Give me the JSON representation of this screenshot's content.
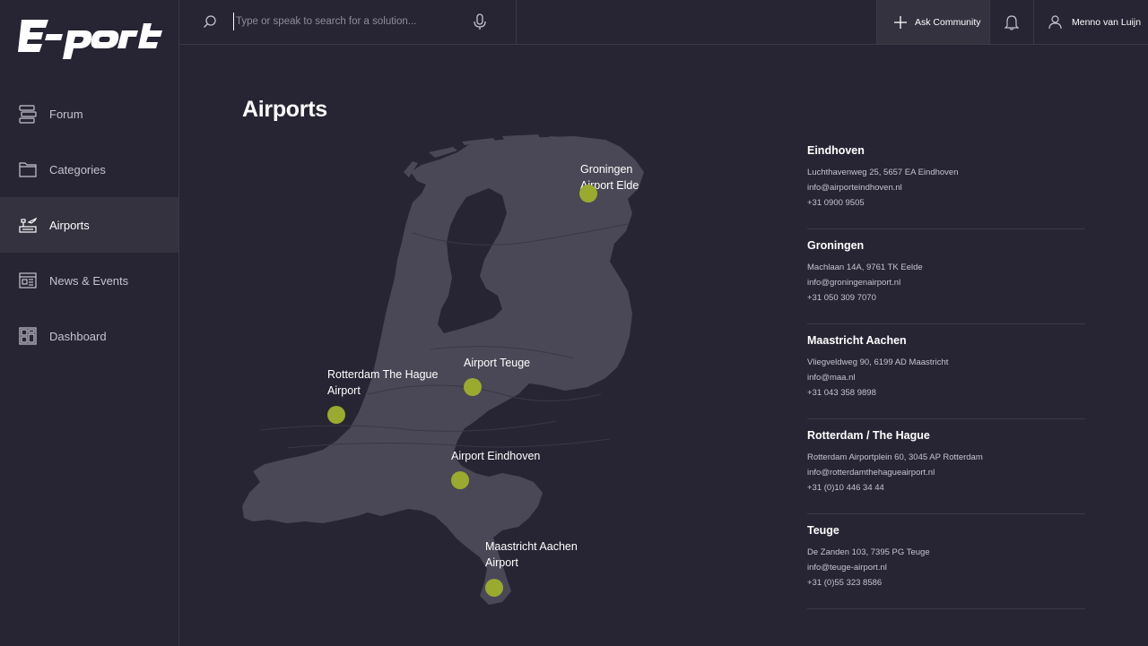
{
  "brand": {
    "logo_text": "E-port",
    "accent": "#9aaa2e"
  },
  "sidebar": {
    "items": [
      {
        "label": "Forum",
        "icon": "forum-icon",
        "active": false
      },
      {
        "label": "Categories",
        "icon": "folder-icon",
        "active": false
      },
      {
        "label": "Airports",
        "icon": "airport-icon",
        "active": true
      },
      {
        "label": "News & Events",
        "icon": "news-icon",
        "active": false
      },
      {
        "label": "Dashboard",
        "icon": "dashboard-icon",
        "active": false
      }
    ]
  },
  "header": {
    "search_placeholder": "Type or speak to search for a solution...",
    "ask_label": "Ask Community",
    "user_name": "Menno van Luijn"
  },
  "main": {
    "title": "Airports",
    "map_markers": [
      {
        "label": "Groningen Airport Elde"
      },
      {
        "label": "Airport Teuge"
      },
      {
        "label": "Rotterdam The Hague Airport"
      },
      {
        "label": "Airport Eindhoven"
      },
      {
        "label": "Maastricht Aachen Airport"
      }
    ],
    "airports": [
      {
        "name": "Eindhoven",
        "address": "Luchthavenweg 25, 5657 EA Eindhoven",
        "email": "info@airporteindhoven.nl",
        "phone": "+31 0900 9505"
      },
      {
        "name": "Groningen",
        "address": "Machlaan 14A, 9761 TK Eelde",
        "email": "info@groningenairport.nl",
        "phone": "+31 050 309 7070"
      },
      {
        "name": "Maastricht Aachen",
        "address": "Vliegveldweg 90, 6199 AD Maastricht",
        "email": "info@maa.nl",
        "phone": "+31 043 358 9898"
      },
      {
        "name": "Rotterdam / The Hague",
        "address": "Rotterdam Airportplein 60, 3045 AP Rotterdam",
        "email": "info@rotterdamthehagueairport.nl",
        "phone": "+31 (0)10 446 34 44"
      },
      {
        "name": "Teuge",
        "address": "De Zanden 103, 7395 PG Teuge",
        "email": "info@teuge-airport.nl",
        "phone": "+31 (0)55 323 8586"
      }
    ]
  }
}
